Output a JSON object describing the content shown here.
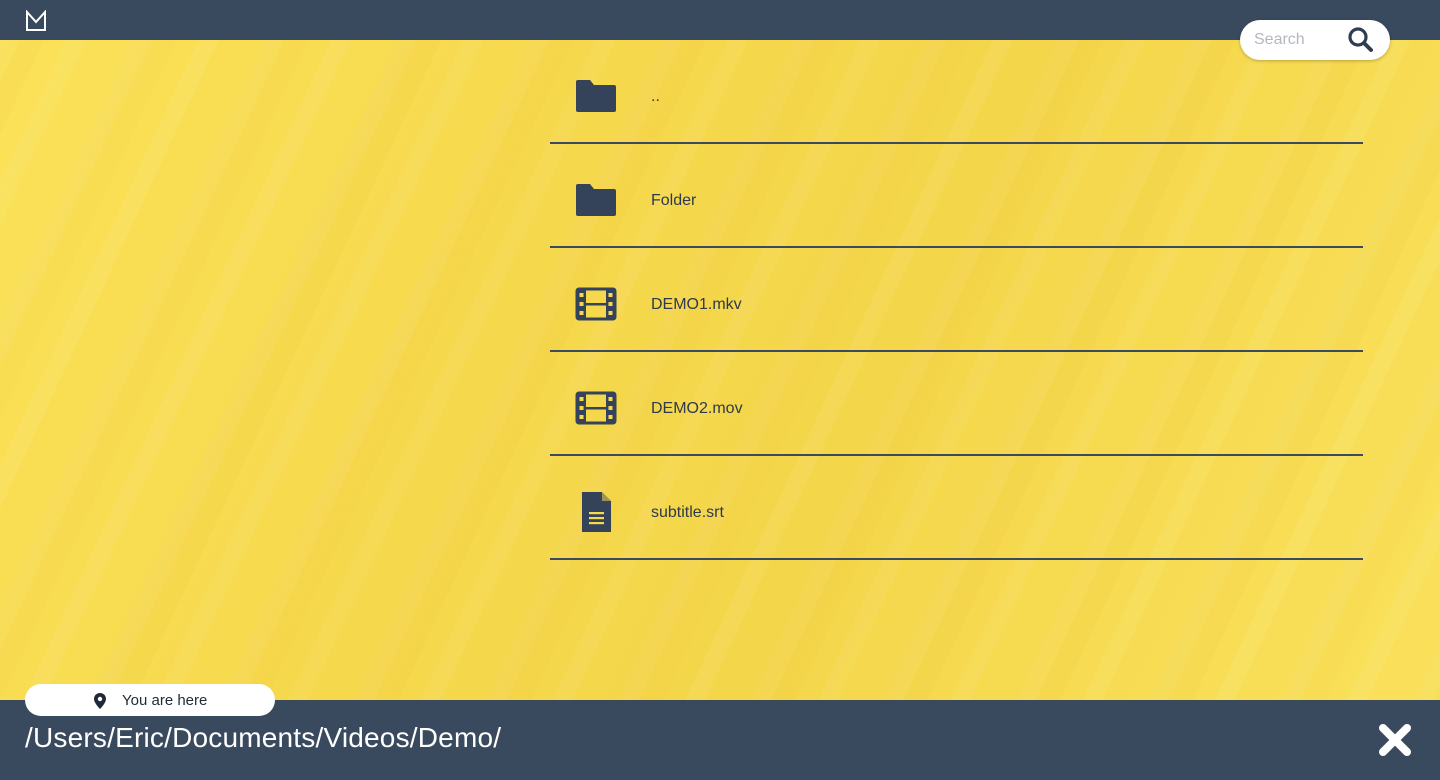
{
  "header": {
    "logo_icon": "m-logo-icon"
  },
  "search": {
    "placeholder": "Search",
    "value": "",
    "icon": "search-icon"
  },
  "files": [
    {
      "name": "..",
      "type": "folder",
      "icon": "folder-icon"
    },
    {
      "name": "Folder",
      "type": "folder",
      "icon": "folder-icon"
    },
    {
      "name": "DEMO1.mkv",
      "type": "video",
      "icon": "film-icon"
    },
    {
      "name": "DEMO2.mov",
      "type": "video",
      "icon": "film-icon"
    },
    {
      "name": "subtitle.srt",
      "type": "document",
      "icon": "document-icon"
    }
  ],
  "footer": {
    "location_label": "You are here",
    "location_icon": "map-pin-icon",
    "path": "/Users/Eric/Documents/Videos/Demo/",
    "close_icon": "close-icon"
  },
  "colors": {
    "bar": "#394a5e",
    "background": "#f7d94a",
    "icon": "#34435a",
    "text_light": "#ffffff"
  }
}
